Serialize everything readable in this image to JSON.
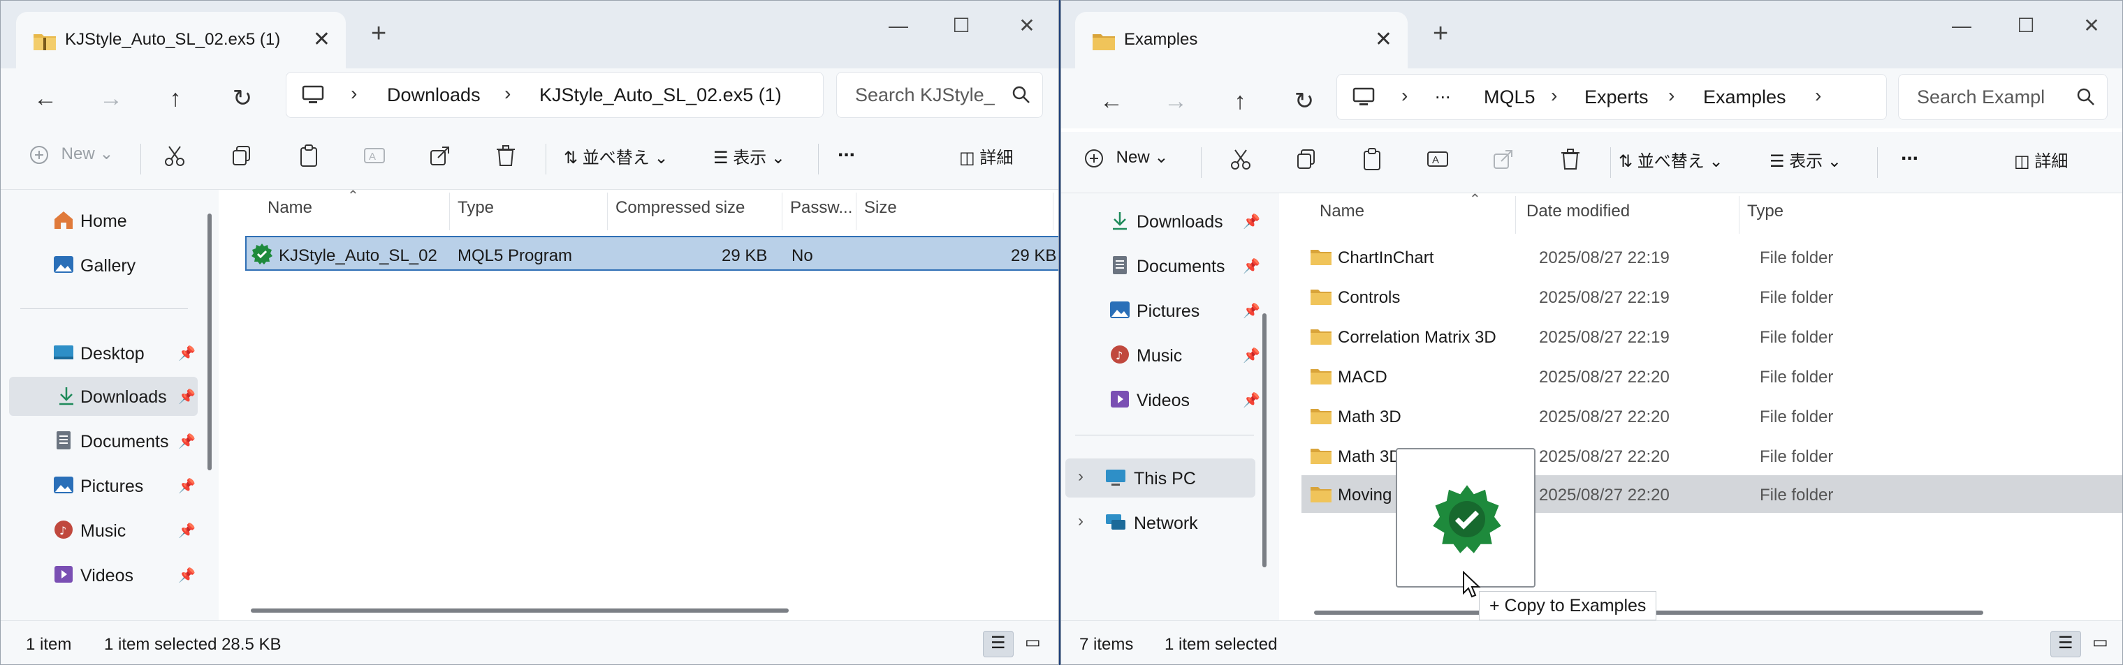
{
  "left_window": {
    "tab_title": "KJStyle_Auto_SL_02.ex5 (1)",
    "breadcrumbs": [
      "Downloads",
      "KJStyle_Auto_SL_02.ex5 (1)"
    ],
    "search_placeholder": "Search KJStyle_",
    "toolbar": {
      "new": "New",
      "sort": "並べ替え",
      "view": "表示",
      "details": "詳細",
      "more": "..."
    },
    "nav": {
      "home": "Home",
      "gallery": "Gallery",
      "desktop": "Desktop",
      "downloads": "Downloads",
      "documents": "Documents",
      "pictures": "Pictures",
      "music": "Music",
      "videos": "Videos"
    },
    "columns": {
      "name": "Name",
      "type": "Type",
      "compressed": "Compressed size",
      "password": "Passw...",
      "size": "Size"
    },
    "files": [
      {
        "name": "KJStyle_Auto_SL_02",
        "type": "MQL5 Program",
        "compressed": "29 KB",
        "password": "No",
        "size": "29 KB"
      }
    ],
    "status": {
      "count": "1 item",
      "selected": "1 item selected  28.5 KB"
    }
  },
  "right_window": {
    "tab_title": "Examples",
    "breadcrumbs": [
      "...",
      "MQL5",
      "Experts",
      "Examples"
    ],
    "search_placeholder": "Search Exampl",
    "toolbar": {
      "new": "New",
      "sort": "並べ替え",
      "view": "表示",
      "details": "詳細",
      "more": "..."
    },
    "nav": {
      "downloads": "Downloads",
      "documents": "Documents",
      "pictures": "Pictures",
      "music": "Music",
      "videos": "Videos",
      "this_pc": "This PC",
      "network": "Network"
    },
    "columns": {
      "name": "Name",
      "date": "Date modified",
      "type": "Type"
    },
    "folders": [
      {
        "name": "ChartInChart",
        "date": "2025/08/27 22:19",
        "type": "File folder"
      },
      {
        "name": "Controls",
        "date": "2025/08/27 22:19",
        "type": "File folder"
      },
      {
        "name": "Correlation Matrix 3D",
        "date": "2025/08/27 22:19",
        "type": "File folder"
      },
      {
        "name": "MACD",
        "date": "2025/08/27 22:20",
        "type": "File folder"
      },
      {
        "name": "Math 3D",
        "date": "2025/08/27 22:20",
        "type": "File folder"
      },
      {
        "name": "Math 3D",
        "date": "2025/08/27 22:20",
        "type": "File folder"
      },
      {
        "name": "Moving",
        "date": "2025/08/27 22:20",
        "type": "File folder"
      }
    ],
    "status": {
      "count": "7 items",
      "selected": "1 item selected"
    }
  },
  "drag": {
    "tooltip": "+ Copy to Examples"
  },
  "colors": {
    "selection_blue": "#b9d0e8",
    "selection_border": "#2f6fb5",
    "folder": "#e8b84a",
    "mql5_green": "#1e8a3c"
  }
}
